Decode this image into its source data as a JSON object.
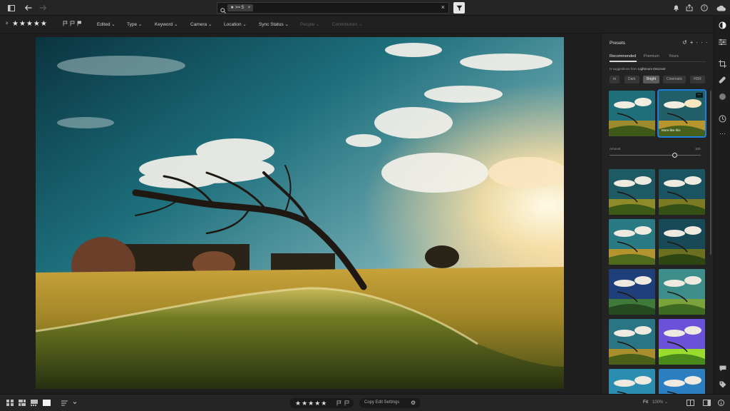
{
  "topbar": {
    "search_chip": "★ >= 5",
    "search_chip_close": "×",
    "search_clear": "×"
  },
  "filterbar": {
    "rating_value": "≥",
    "stars": "★★★★★",
    "items": [
      {
        "label": "Edited ⌄",
        "enabled": true
      },
      {
        "label": "Type ⌄",
        "enabled": true
      },
      {
        "label": "Keyword ⌄",
        "enabled": true
      },
      {
        "label": "Camera ⌄",
        "enabled": true
      },
      {
        "label": "Location ⌄",
        "enabled": true
      },
      {
        "label": "Sync Status ⌄",
        "enabled": true
      },
      {
        "label": "People ⌄",
        "enabled": false
      },
      {
        "label": "Contributors ⌄",
        "enabled": false
      }
    ]
  },
  "presets": {
    "title": "Presets",
    "tabs": [
      {
        "label": "Recommended",
        "active": true
      },
      {
        "label": "Premium",
        "active": false
      },
      {
        "label": "Yours",
        "active": false
      }
    ],
    "suggestions_prefix": "N suggestions from",
    "suggestions_source": "Lightroom Discover",
    "categories": [
      {
        "label": "m",
        "active": false
      },
      {
        "label": "Dark",
        "active": false
      },
      {
        "label": "Bright",
        "active": true
      },
      {
        "label": "Cinematic",
        "active": false
      },
      {
        "label": "HDR",
        "active": false
      }
    ],
    "selected_label": "More like this",
    "more_icon": "···",
    "amount_label": "Amount",
    "amount_value": "100",
    "amount_fraction": 0.72
  },
  "bottombar": {
    "stars": "★★★★★",
    "copy_label": "Copy Edit Settings",
    "fit_label": "Fit",
    "zoom_label": "100% ⌄"
  },
  "colors": {
    "accent": "#1d7fdb",
    "background": "#1e1e1e",
    "panel": "#232323"
  }
}
